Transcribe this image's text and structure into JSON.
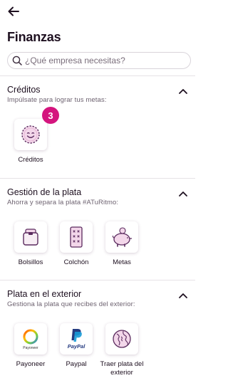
{
  "header": {
    "title": "Finanzas",
    "back_icon": "arrow-left-icon"
  },
  "search": {
    "placeholder": "¿Qué empresa necesitas?",
    "value": "",
    "icon": "search-icon"
  },
  "sections": [
    {
      "title": "Créditos",
      "subtitle": "Impúlsate para lograr tus metas:",
      "items": [
        {
          "label": "Créditos",
          "icon": "smiley-icon",
          "badge": "3"
        }
      ]
    },
    {
      "title": "Gestión de la plata",
      "subtitle": "Ahorra y separa la plata #ATuRitmo:",
      "items": [
        {
          "label": "Bolsillos",
          "icon": "pocket-icon"
        },
        {
          "label": "Colchón",
          "icon": "mattress-icon"
        },
        {
          "label": "Metas",
          "icon": "piggy-bank-icon"
        }
      ]
    },
    {
      "title": "Plata en el exterior",
      "subtitle": "Gestiona la plata que recibes del exterior:",
      "items": [
        {
          "label": "Payoneer",
          "icon": "payoneer-logo",
          "logo_text": "Payoneer"
        },
        {
          "label": "Paypal",
          "icon": "paypal-logo",
          "logo_text": "PayPal"
        },
        {
          "label": "Traer plata del exterior",
          "icon": "globe-icon"
        }
      ]
    }
  ],
  "colors": {
    "accent": "#d4157e",
    "icon_purple": "#5a2a5e",
    "icon_pink": "#e7b6d6",
    "paypal_blue": "#253b80",
    "paypal_light": "#179bd7"
  }
}
